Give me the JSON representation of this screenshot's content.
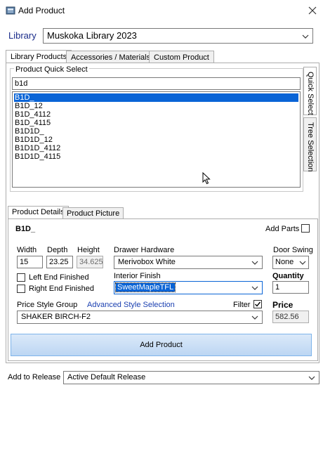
{
  "window": {
    "title": "Add Product"
  },
  "library": {
    "label": "Library",
    "value": "Muskoka Library 2023"
  },
  "tabs": [
    "Library Products",
    "Accessories / Materials",
    "Custom Product"
  ],
  "side_tabs": [
    "Quick Select",
    "Tree Selection"
  ],
  "quick_select": {
    "group_label": "Product Quick Select",
    "search_value": "b1d",
    "items": [
      "B1D_",
      "B1D_12",
      "B1D_4112",
      "B1D_4115",
      "B1D1D_",
      "B1D1D_12",
      "B1D1D_4112",
      "B1D1D_4115"
    ],
    "selected_index": 0
  },
  "detail_tabs": [
    "Product Details",
    "Product Picture"
  ],
  "details": {
    "product_code": "B1D_",
    "add_parts_label": "Add Parts",
    "width_label": "Width",
    "width_value": "15",
    "depth_label": "Depth",
    "depth_value": "23.25",
    "height_label": "Height",
    "height_value": "34.625",
    "left_end_label": "Left End Finished",
    "right_end_label": "Right End Finished",
    "drawer_hardware_label": "Drawer Hardware",
    "drawer_hardware_value": "Merivobox White",
    "interior_finish_label": "Interior Finish",
    "interior_finish_value": "SweetMapleTFL",
    "door_swing_label": "Door Swing",
    "door_swing_value": "None",
    "quantity_label": "Quantity",
    "quantity_value": "1",
    "price_style_group_label": "Price Style Group",
    "advanced_style_link": "Advanced Style Selection",
    "filter_label": "Filter",
    "price_style_value": "SHAKER BIRCH-F2",
    "price_label": "Price",
    "price_value": "582.56"
  },
  "add_button_label": "Add Product",
  "release": {
    "label": "Add to Release",
    "value": "Active Default Release"
  },
  "colors": {
    "selection": "#0a64d6",
    "label_blue": "#1a2c8a",
    "link": "#1a3fb0",
    "button_top": "#dbe9f9",
    "button_bottom": "#bcd6f3"
  },
  "icons": [
    "app-icon",
    "close-icon",
    "chevron-down-icon",
    "checkmark-icon",
    "mouse-cursor-icon"
  ]
}
